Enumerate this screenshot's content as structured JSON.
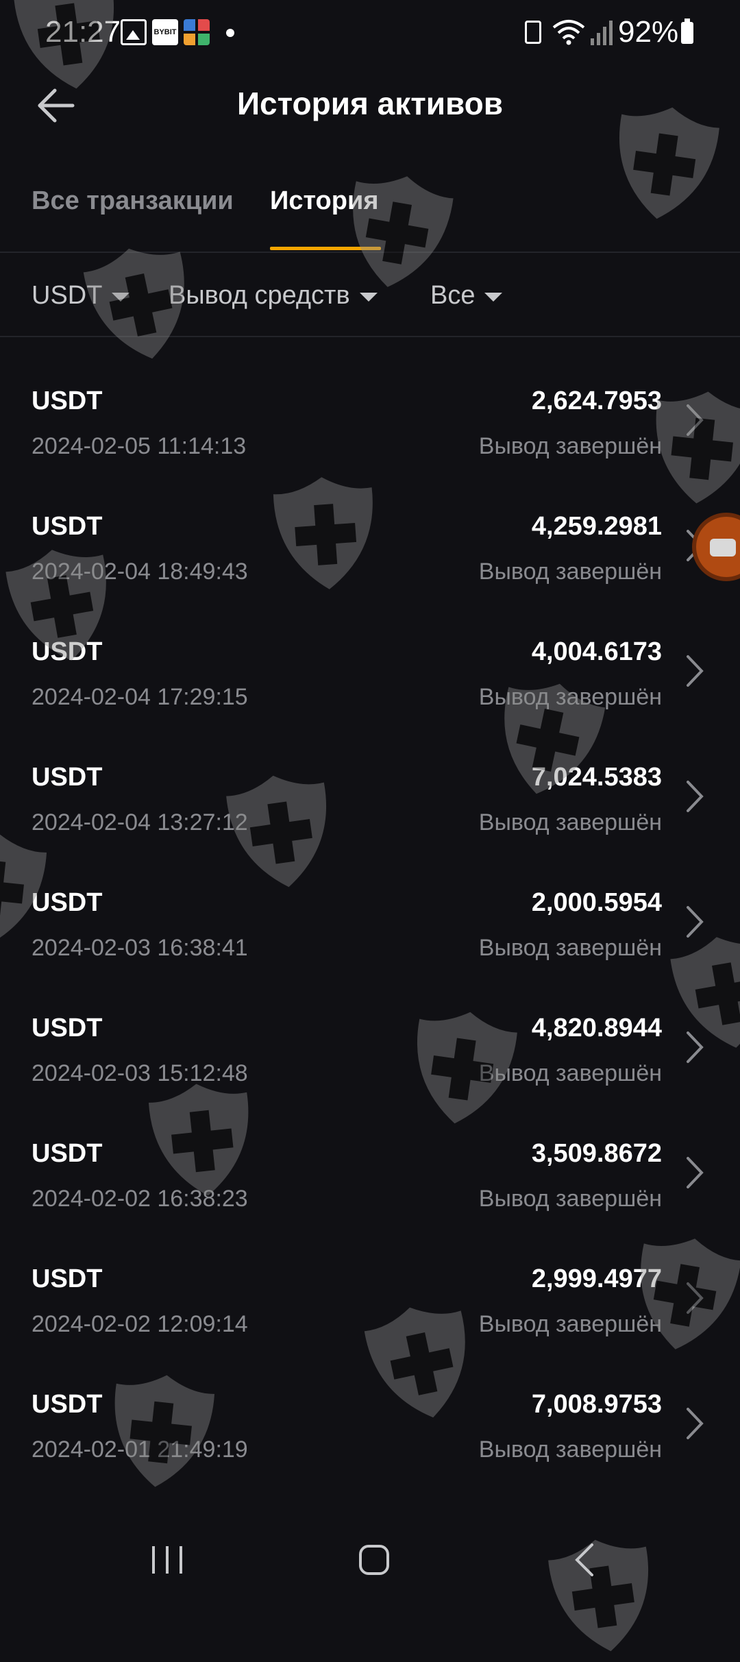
{
  "status_bar": {
    "time": "21:27",
    "battery": "92%",
    "notification_icons": [
      "gallery-icon",
      "bybit-app-icon",
      "widget-icon"
    ]
  },
  "header": {
    "title": "История активов",
    "back_icon": "arrow-left-icon"
  },
  "tabs": [
    {
      "label": "Все транзакции",
      "active": false
    },
    {
      "label": "История",
      "active": true
    }
  ],
  "colors": {
    "accent": "#f7a600",
    "background": "#101014",
    "muted_text": "#8a8b90"
  },
  "filters": {
    "coin": "USDT",
    "type": "Вывод средств",
    "status": "Все"
  },
  "transactions": [
    {
      "coin": "USDT",
      "date": "2024-02-05 11:14:13",
      "amount": "2,624.7953",
      "status": "Вывод завершён"
    },
    {
      "coin": "USDT",
      "date": "2024-02-04 18:49:43",
      "amount": "4,259.2981",
      "status": "Вывод завершён"
    },
    {
      "coin": "USDT",
      "date": "2024-02-04 17:29:15",
      "amount": "4,004.6173",
      "status": "Вывод завершён"
    },
    {
      "coin": "USDT",
      "date": "2024-02-04 13:27:12",
      "amount": "7,024.5383",
      "status": "Вывод завершён"
    },
    {
      "coin": "USDT",
      "date": "2024-02-03 16:38:41",
      "amount": "2,000.5954",
      "status": "Вывод завершён"
    },
    {
      "coin": "USDT",
      "date": "2024-02-03 15:12:48",
      "amount": "4,820.8944",
      "status": "Вывод завершён"
    },
    {
      "coin": "USDT",
      "date": "2024-02-02 16:38:23",
      "amount": "3,509.8672",
      "status": "Вывод завершён"
    },
    {
      "coin": "USDT",
      "date": "2024-02-02 12:09:14",
      "amount": "2,999.4977",
      "status": "Вывод завершён"
    },
    {
      "coin": "USDT",
      "date": "2024-02-01 21:49:19",
      "amount": "7,008.9753",
      "status": "Вывод завершён"
    }
  ],
  "nav_bar": {
    "icons": [
      "recent-apps-icon",
      "home-icon",
      "back-icon"
    ]
  }
}
